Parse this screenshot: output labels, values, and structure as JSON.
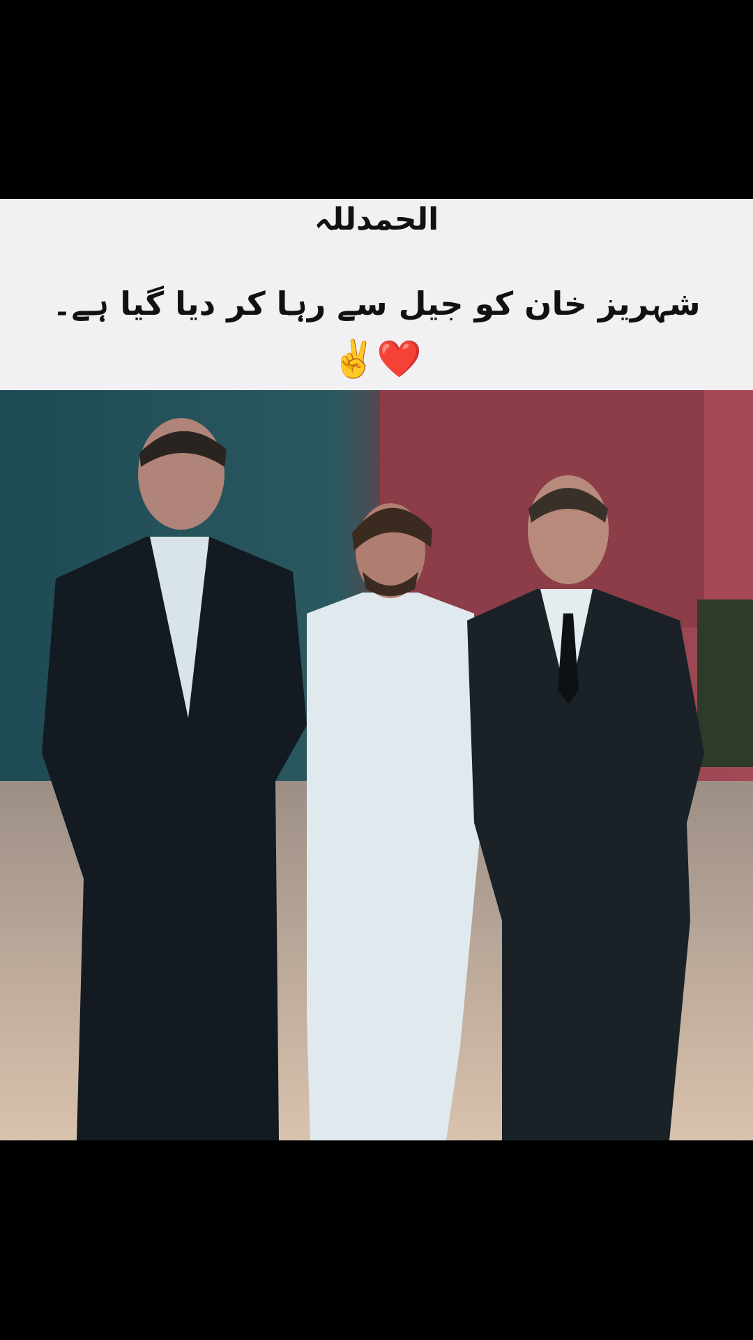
{
  "caption": {
    "line1": "الحمدللہ",
    "line2": "شہریز خان کو جیل سے رہا کر دیا گیا ہے۔",
    "emoji": "✌️❤️"
  },
  "colors": {
    "background": "#000000",
    "caption_panel": "#f1f1f3",
    "caption_text": "#111111"
  }
}
